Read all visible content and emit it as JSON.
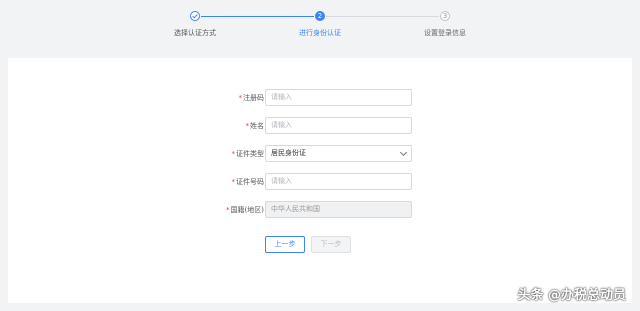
{
  "stepper": {
    "steps": [
      {
        "number": "",
        "label": "选择认证方式",
        "state": "done"
      },
      {
        "number": "2",
        "label": "进行身份认证",
        "state": "active"
      },
      {
        "number": "3",
        "label": "设置登录信息",
        "state": "pending"
      }
    ],
    "colors": {
      "active": "#3e82f7",
      "pending": "#bfc4cc"
    }
  },
  "form": {
    "required_mark": "*",
    "fields": [
      {
        "label": "注册码",
        "placeholder": "请输入",
        "required": true
      },
      {
        "label": "姓名",
        "placeholder": "请输入",
        "required": true
      },
      {
        "label": "证件类型",
        "value": "居民身份证",
        "required": true,
        "type": "select"
      },
      {
        "label": "证件号码",
        "placeholder": "请输入",
        "required": true
      },
      {
        "label": "国籍(地区)",
        "value": "中华人民共和国",
        "required": true,
        "disabled": true
      }
    ]
  },
  "buttons": {
    "prev": "上一步",
    "next": "下一步"
  },
  "watermark": "头条 @办税总动员"
}
